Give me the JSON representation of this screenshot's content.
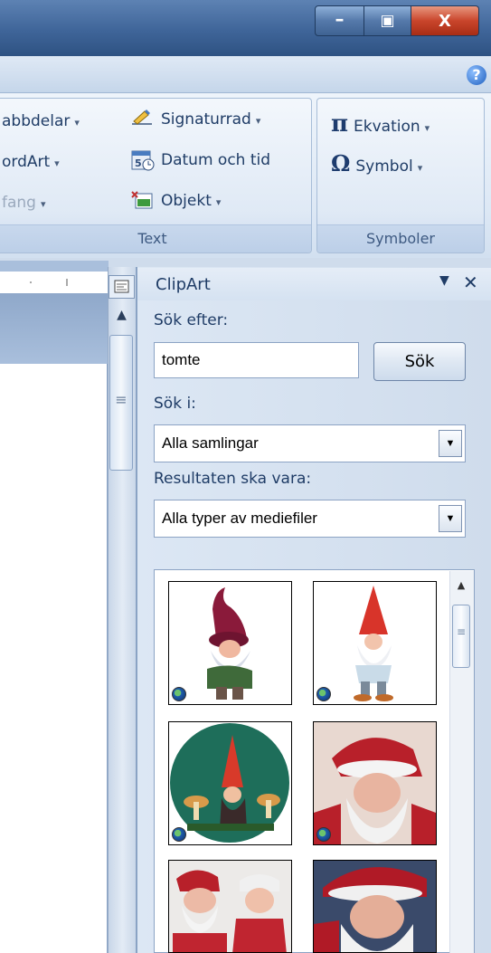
{
  "titlebar": {
    "minimize_glyph": "–",
    "maximize_glyph": "▣",
    "close_glyph": "X"
  },
  "help_glyph": "?",
  "ribbon": {
    "text_group": {
      "label": "Text",
      "items": [
        {
          "label": "abbdelar",
          "arrow": "▾"
        },
        {
          "label": "ordArt",
          "arrow": "▾"
        },
        {
          "label": "fang",
          "arrow": "▾"
        }
      ],
      "items2": [
        {
          "label": "Signaturrad",
          "arrow": "▾",
          "icon": "signature-line-icon"
        },
        {
          "label": "Datum och tid",
          "icon": "date-time-icon"
        },
        {
          "label": "Objekt",
          "arrow": "▾",
          "icon": "object-icon"
        }
      ]
    },
    "symbols_group": {
      "label": "Symboler",
      "items": [
        {
          "label": "Ekvation",
          "arrow": "▾",
          "icon": "pi-icon",
          "glyph": "π"
        },
        {
          "label": "Symbol",
          "arrow": "▾",
          "icon": "omega-icon",
          "glyph": "Ω"
        }
      ]
    }
  },
  "scrollbar": {
    "up_arrow": "▲",
    "grip": "≡"
  },
  "pane": {
    "title": "ClipArt",
    "menu_glyph": "▼",
    "close_glyph": "✕",
    "search_label": "Sök efter:",
    "search_value": "tomte",
    "search_button": "Sök",
    "search_in_label": "Sök i:",
    "search_in_value": "Alla samlingar",
    "results_label": "Resultaten ska vara:",
    "results_value": "Alla typer av mediefiler",
    "dropdown_glyph": "▼"
  },
  "gallery": {
    "up_arrow": "▲",
    "grip": "≡",
    "item_count": 6
  }
}
